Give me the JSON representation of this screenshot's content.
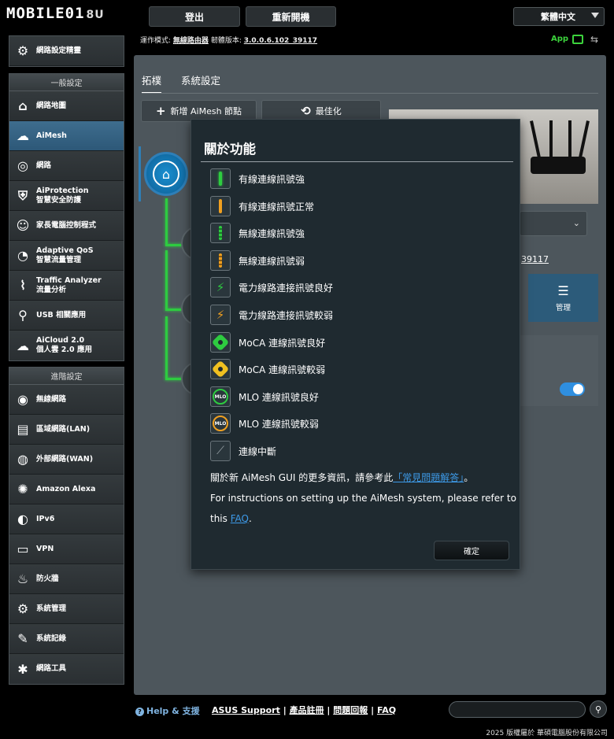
{
  "header": {
    "logo_text": "MOBILE01",
    "logo_suffix": "8U",
    "logout_label": "登出",
    "reboot_label": "重新開機",
    "language": "繁體中文"
  },
  "status": {
    "mode_label": "運作模式:",
    "mode_value": "無線路由器",
    "firmware_label": "韌體版本:",
    "firmware_value": "3.0.0.6.102_39117",
    "app_label": "App"
  },
  "sidebar": {
    "quick_setup": "網路設定精靈",
    "general_header": "一般設定",
    "general_items": [
      {
        "line1": "網路地圖",
        "line2": "",
        "icon": "map-icon"
      },
      {
        "line1": "AiMesh",
        "line2": "",
        "icon": "aimesh-icon"
      },
      {
        "line1": "網路",
        "line2": "",
        "icon": "globe-icon"
      },
      {
        "line1": "AiProtection",
        "line2": "智慧安全防護",
        "icon": "shield-icon"
      },
      {
        "line1": "家長電腦控制程式",
        "line2": "",
        "icon": "family-icon"
      },
      {
        "line1": "Adaptive QoS",
        "line2": "智慧流量管理",
        "icon": "qos-icon"
      },
      {
        "line1": "Traffic Analyzer",
        "line2": "流量分析",
        "icon": "traffic-icon"
      },
      {
        "line1": "USB 相關應用",
        "line2": "",
        "icon": "usb-icon"
      },
      {
        "line1": "AiCloud 2.0",
        "line2": "個人雲 2.0 應用",
        "icon": "cloud-icon"
      }
    ],
    "advanced_header": "進階設定",
    "advanced_items": [
      {
        "line1": "無線網路",
        "icon": "wifi-icon"
      },
      {
        "line1": "區域網路(LAN)",
        "icon": "lan-icon"
      },
      {
        "line1": "外部網路(WAN)",
        "icon": "wan-icon"
      },
      {
        "line1": "Amazon Alexa",
        "icon": "alexa-icon"
      },
      {
        "line1": "IPv6",
        "icon": "ipv6-icon"
      },
      {
        "line1": "VPN",
        "icon": "vpn-icon"
      },
      {
        "line1": "防火牆",
        "icon": "firewall-icon"
      },
      {
        "line1": "系統管理",
        "icon": "gear-icon"
      },
      {
        "line1": "系統記錄",
        "icon": "log-icon"
      },
      {
        "line1": "網路工具",
        "icon": "tools-icon"
      }
    ]
  },
  "main": {
    "tabs": [
      "拓樸",
      "系統設定"
    ],
    "add_node_label": "新增 AiMesh 節點",
    "optimize_label": "最佳化",
    "firmware_partial": "39117",
    "manage_label": "管理"
  },
  "modal": {
    "title": "關於功能",
    "legend": [
      {
        "label": "有線連線訊號強",
        "icon": "wired-strong-icon"
      },
      {
        "label": "有線連線訊號正常",
        "icon": "wired-normal-icon"
      },
      {
        "label": "無線連線訊號強",
        "icon": "wireless-strong-icon"
      },
      {
        "label": "無線連線訊號弱",
        "icon": "wireless-weak-icon"
      },
      {
        "label": "電力線路連接訊號良好",
        "icon": "powerline-good-icon"
      },
      {
        "label": "電力線路連接訊號較弱",
        "icon": "powerline-weak-icon"
      },
      {
        "label": "MoCA 連線訊號良好",
        "icon": "moca-good-icon"
      },
      {
        "label": "MoCA 連線訊號較弱",
        "icon": "moca-weak-icon"
      },
      {
        "label": "MLO 連線訊號良好",
        "icon": "mlo-good-icon"
      },
      {
        "label": "MLO 連線訊號較弱",
        "icon": "mlo-weak-icon"
      },
      {
        "label": "連線中斷",
        "icon": "disconnected-icon"
      }
    ],
    "info_prefix": "關於新 AiMesh GUI 的更多資訊，請參考此",
    "info_link": "「常見問題解答」",
    "info_suffix": "。",
    "instr_line1": "For instructions on setting up the AiMesh system, please refer to",
    "instr_line2_prefix": "this ",
    "instr_link": "FAQ",
    "instr_line2_suffix": ".",
    "ok_label": "確定",
    "mlo_text": "MLO"
  },
  "footer": {
    "help_label": "Help & 支援",
    "links": [
      "ASUS Support",
      "產品註冊",
      "問題回報",
      "FAQ"
    ],
    "separator": " | ",
    "copyright": "2025 版權屬於 華碩電腦股份有限公司"
  },
  "colors": {
    "accent_blue": "#2d5878",
    "signal_green": "#2ecc40",
    "signal_orange": "#f0a020",
    "link_blue": "#3d9ae8"
  }
}
